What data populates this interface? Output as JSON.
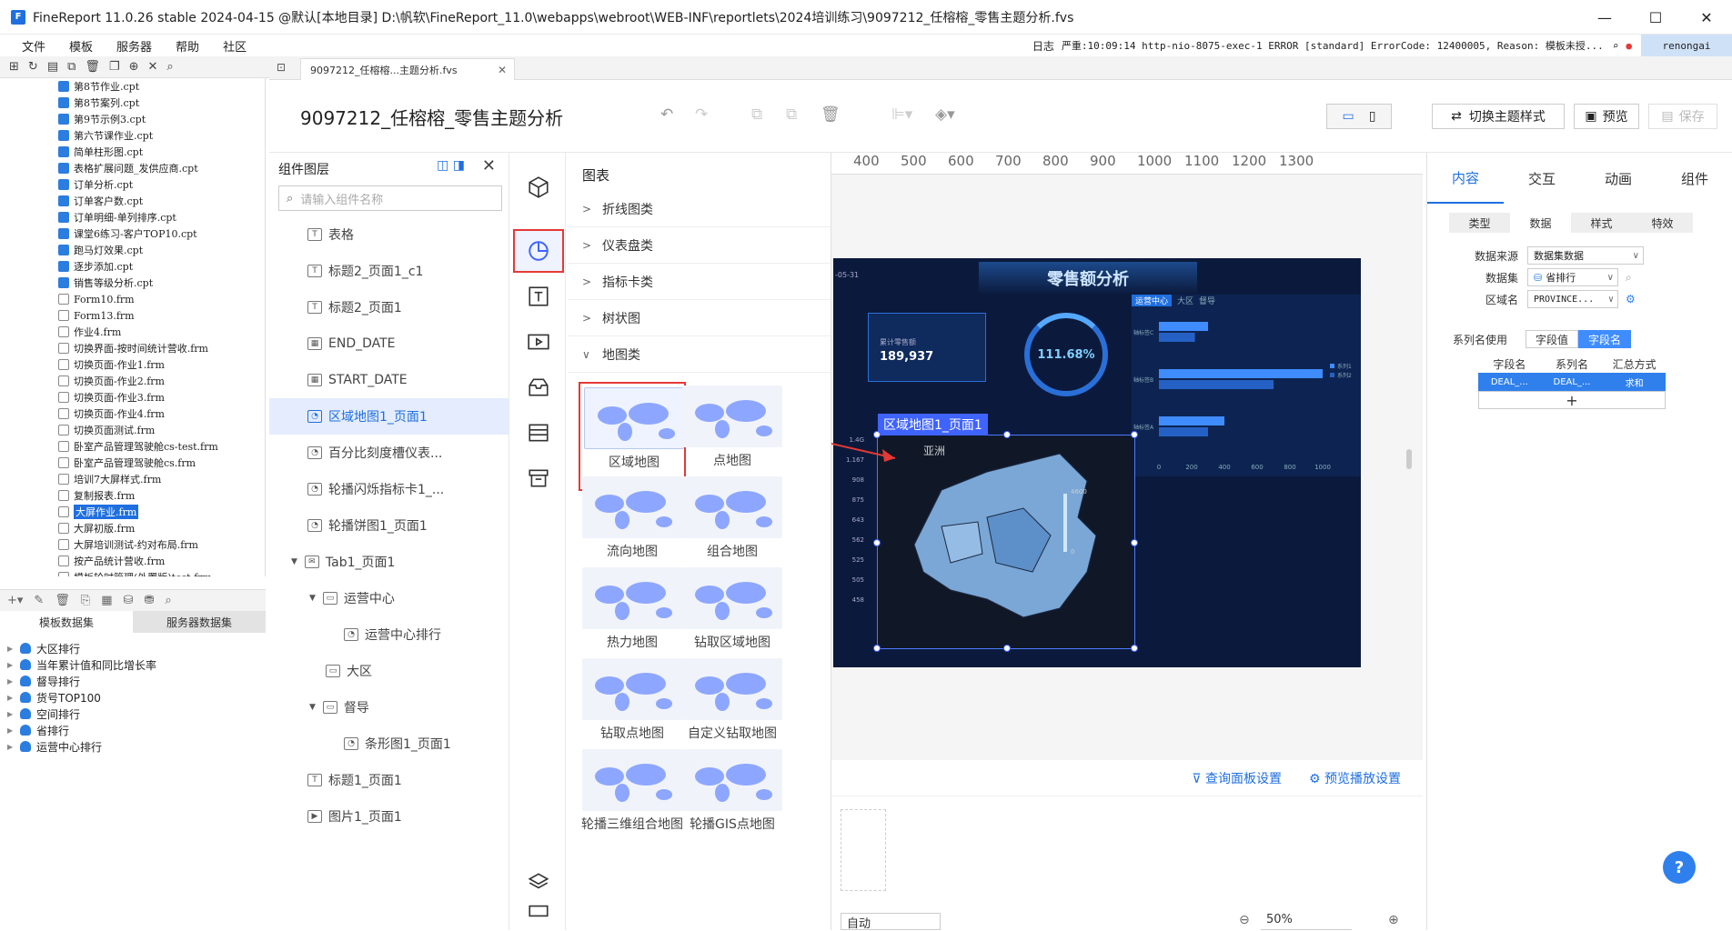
{
  "title_bar": {
    "title": "FineReport 11.0.26 stable 2024-04-15 @默认[本地目录]   D:\\帆软\\FineReport_11.0\\webapps\\webroot\\WEB-INF\\reportlets\\2024培训练习\\9097212_任榕榕_零售主题分析.fvs"
  },
  "menu": [
    "文件",
    "模板",
    "服务器",
    "帮助",
    "社区"
  ],
  "status_bar": {
    "log_label": "日志",
    "message": "严重:10:09:14 http-nio-8075-exec-1 ERROR [standard] ErrorCode: 12400005, Reason: 模板未授...",
    "user": "renongai"
  },
  "file_tree": [
    {
      "name": "第8节作业.cpt",
      "type": "cpt"
    },
    {
      "name": "第8节案列.cpt",
      "type": "cpt"
    },
    {
      "name": "第9节示例3.cpt",
      "type": "cpt"
    },
    {
      "name": "第六节课作业.cpt",
      "type": "cpt"
    },
    {
      "name": "简单柱形图.cpt",
      "type": "cpt"
    },
    {
      "name": "表格扩展问题_发供应商.cpt",
      "type": "cpt"
    },
    {
      "name": "订单分析.cpt",
      "type": "cpt"
    },
    {
      "name": "订单客户数.cpt",
      "type": "cpt"
    },
    {
      "name": "订单明细-单列排序.cpt",
      "type": "cpt"
    },
    {
      "name": "课堂6练习-客户TOP10.cpt",
      "type": "cpt"
    },
    {
      "name": "跑马灯效果.cpt",
      "type": "cpt"
    },
    {
      "name": "逐步添加.cpt",
      "type": "cpt"
    },
    {
      "name": "销售等级分析.cpt",
      "type": "cpt"
    },
    {
      "name": "Form10.frm",
      "type": "frm"
    },
    {
      "name": "Form13.frm",
      "type": "frm"
    },
    {
      "name": "作业4.frm",
      "type": "frm"
    },
    {
      "name": "切换界面-按时间统计营收.frm",
      "type": "frm"
    },
    {
      "name": "切换页面-作业1.frm",
      "type": "frm"
    },
    {
      "name": "切换页面-作业2.frm",
      "type": "frm"
    },
    {
      "name": "切换页面-作业3.frm",
      "type": "frm"
    },
    {
      "name": "切换页面-作业4.frm",
      "type": "frm"
    },
    {
      "name": "切换页面测试.frm",
      "type": "frm"
    },
    {
      "name": "卧室产品管理驾驶舱cs-test.frm",
      "type": "frm"
    },
    {
      "name": "卧室产品管理驾驶舱cs.frm",
      "type": "frm"
    },
    {
      "name": "培训7大屏样式.frm",
      "type": "frm"
    },
    {
      "name": "复制报表.frm",
      "type": "frm"
    },
    {
      "name": "大屏作业.frm",
      "type": "frm",
      "selected": true
    },
    {
      "name": "大屏初版.frm",
      "type": "frm"
    },
    {
      "name": "大屏培训测试-约对布局.frm",
      "type": "frm"
    },
    {
      "name": "按产品统计营收.frm",
      "type": "frm"
    },
    {
      "name": "模板轮时管理(外置版)test.frm",
      "type": "frm"
    }
  ],
  "dataset_tabs": {
    "template": "模板数据集",
    "server": "服务器数据集"
  },
  "datasets": [
    "大区排行",
    "当年累计值和同比增长率",
    "督导排行",
    "货号TOP100",
    "空间排行",
    "省排行",
    "运营中心排行"
  ],
  "doc_tab": {
    "label": "9097212_任榕榕...主题分析.fvs"
  },
  "doc_title": "9097212_任榕榕_零售主题分析",
  "header_buttons": {
    "switch_theme": "切换主题样式",
    "preview": "预览",
    "save": "保存"
  },
  "layer_panel": {
    "title": "组件图层",
    "search_placeholder": "请输入组件名称",
    "items": [
      {
        "label": "表格",
        "indent": 0,
        "icon": "T"
      },
      {
        "label": "标题2_页面1_c1",
        "indent": 0,
        "icon": "T"
      },
      {
        "label": "标题2_页面1",
        "indent": 0,
        "icon": "T"
      },
      {
        "label": "END_DATE",
        "indent": 0,
        "icon": "▦"
      },
      {
        "label": "START_DATE",
        "indent": 0,
        "icon": "▦"
      },
      {
        "label": "区域地图1_页面1",
        "indent": 0,
        "icon": "◔",
        "selected": true
      },
      {
        "label": "百分比刻度槽仪表...",
        "indent": 0,
        "icon": "◔"
      },
      {
        "label": "轮播闪烁指标卡1_...",
        "indent": 0,
        "icon": "◔"
      },
      {
        "label": "轮播饼图1_页面1",
        "indent": 0,
        "icon": "◔"
      },
      {
        "label": "Tab1_页面1",
        "indent": 0,
        "icon": "✉",
        "caret": "▼"
      },
      {
        "label": "运营中心",
        "indent": 1,
        "icon": "▭",
        "caret": "▼"
      },
      {
        "label": "运营中心排行",
        "indent": 2,
        "icon": "◔"
      },
      {
        "label": "大区",
        "indent": 1,
        "icon": "▭"
      },
      {
        "label": "督导",
        "indent": 1,
        "icon": "▭",
        "caret": "▼"
      },
      {
        "label": "条形图1_页面1",
        "indent": 2,
        "icon": "◔"
      },
      {
        "label": "标题1_页面1",
        "indent": 0,
        "icon": "T"
      },
      {
        "label": "图片1_页面1",
        "indent": 0,
        "icon": "▶"
      }
    ]
  },
  "chart_panel": {
    "title": "图表",
    "categories": [
      {
        "label": "折线图类",
        "open": false
      },
      {
        "label": "仪表盘类",
        "open": false
      },
      {
        "label": "指标卡类",
        "open": false
      },
      {
        "label": "树状图",
        "open": false
      },
      {
        "label": "地图类",
        "open": true
      }
    ],
    "map_types": [
      "区域地图",
      "点地图",
      "流向地图",
      "组合地图",
      "热力地图",
      "钻取区域地图",
      "钻取点地图",
      "自定义钻取地图",
      "轮播三维组合地图",
      "轮播GIS点地图"
    ]
  },
  "ruler_marks": [
    "400",
    "500",
    "600",
    "700",
    "800",
    "900",
    "1000",
    "1100",
    "1200",
    "1300"
  ],
  "dashboard": {
    "title": "零售额分析",
    "date": "-05-31",
    "kpi_label": "累计零售额",
    "kpi_value": "189,937",
    "gauge_value": "111.68%",
    "bar_tabs": [
      "运营中心",
      "大区",
      "督导"
    ],
    "bar_ticks": [
      "0",
      "200",
      "400",
      "600",
      "800",
      "1000"
    ],
    "bar_legend": [
      "系列1",
      "系列2"
    ],
    "bar_rows": [
      "轴标签C",
      "轴标签B",
      "轴标签A"
    ],
    "bar_values": [
      {
        "s1": 300,
        "s2": 220
      },
      {
        "s1": 1000,
        "s2": 700
      },
      {
        "s1": 400,
        "s2": 300
      }
    ],
    "map_label": "区域地图1_页面1",
    "map_region": "亚洲",
    "map_max": "4600",
    "map_min": "0",
    "left_values": [
      "1.4G",
      "1.167",
      "908",
      "875",
      "643",
      "562",
      "525",
      "505",
      "458"
    ]
  },
  "bottom_links": {
    "query": "查询面板设置",
    "playback": "预览播放设置"
  },
  "bottom_bar": {
    "auto": "自动",
    "zoom": "50%"
  },
  "right_panel": {
    "tabs": [
      "内容",
      "交互",
      "动画",
      "组件"
    ],
    "subtabs": [
      "类型",
      "数据",
      "样式",
      "特效"
    ],
    "datasource_label": "数据来源",
    "datasource_value": "数据集数据",
    "dataset_label": "数据集",
    "dataset_value": "省排行",
    "area_label": "区域名",
    "area_value": "PROVINCE...",
    "series_label": "系列名使用",
    "seg_value": "字段值",
    "seg_name": "字段名",
    "table_head": [
      "字段名",
      "系列名",
      "汇总方式"
    ],
    "table_row": [
      "DEAL_...",
      "DEAL_...",
      "求和"
    ],
    "add": "+"
  },
  "help": "?",
  "colors": {
    "accent": "#1f6fe0",
    "highlight_red": "#e53935",
    "dash_bg": "#0b1a3c"
  }
}
